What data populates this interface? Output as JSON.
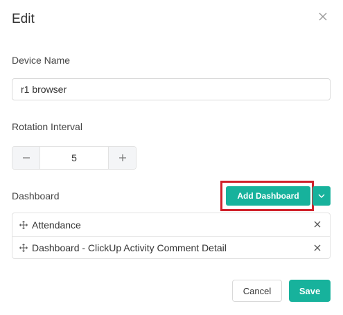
{
  "dialog": {
    "title": "Edit"
  },
  "device_name": {
    "label": "Device Name",
    "value": "r1 browser"
  },
  "rotation_interval": {
    "label": "Rotation Interval",
    "value": "5"
  },
  "dashboard": {
    "label": "Dashboard",
    "add_button_label": "Add Dashboard",
    "items": [
      {
        "label": "Attendance"
      },
      {
        "label": "Dashboard - ClickUp Activity Comment Detail"
      }
    ]
  },
  "footer": {
    "cancel_label": "Cancel",
    "save_label": "Save"
  },
  "colors": {
    "accent": "#17b29c",
    "highlight": "#d0202a"
  },
  "icons": [
    "close-icon",
    "minus-icon",
    "plus-icon",
    "chevron-down-icon",
    "drag-handle-icon",
    "remove-icon"
  ]
}
